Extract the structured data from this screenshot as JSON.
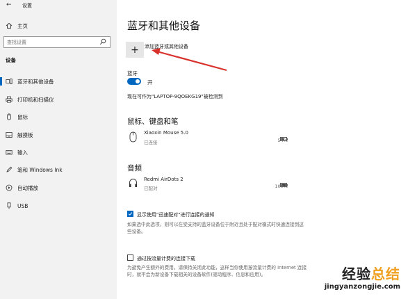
{
  "window": {
    "title": "设置"
  },
  "sidebar": {
    "home_label": "主页",
    "search_placeholder": "查找设置",
    "section_label": "设备",
    "items": [
      {
        "label": "蓝牙和其他设备",
        "icon": "bluetooth-devices-icon",
        "active": true
      },
      {
        "label": "打印机和扫描仪",
        "icon": "printer-icon"
      },
      {
        "label": "鼠标",
        "icon": "mouse-icon"
      },
      {
        "label": "触摸板",
        "icon": "touchpad-icon"
      },
      {
        "label": "输入",
        "icon": "keyboard-icon"
      },
      {
        "label": "笔和 Windows Ink",
        "icon": "pen-icon"
      },
      {
        "label": "自动播放",
        "icon": "autoplay-icon"
      },
      {
        "label": "USB",
        "icon": "usb-icon"
      }
    ]
  },
  "main": {
    "title": "蓝牙和其他设备",
    "add_device_label": "添加蓝牙或其他设备",
    "bluetooth_label": "蓝牙",
    "bluetooth_state": "开",
    "discoverable_text": "现在可作为\"LAPTOP-9QOEKG19\"被检测到",
    "categories": [
      {
        "title": "鼠标、键盘和笔",
        "devices": [
          {
            "name": "Xiaoxin Mouse 5.0",
            "status": "已连接",
            "battery": "54%",
            "icon": "mouse-icon"
          }
        ]
      },
      {
        "title": "音频",
        "devices": [
          {
            "name": "Redmi AirDots 2",
            "status": "已配对",
            "battery": "100%",
            "icon": "headphones-icon"
          }
        ]
      }
    ],
    "swift_pair": {
      "checked": true,
      "label": "显示使用\"迅速配对\"进行连接的通知",
      "description": "如果选中此选项，则可以在受支持的蓝牙设备位于附近且处于配对模式时快速连接到这些设备。"
    },
    "metered": {
      "checked": false,
      "label": "通过按流量计费的连接下载",
      "description": "为避免产生额外的费用，请保持关闭此功能，这样当你使用按流量计费的 Internet 连接时，就不会为新设备下载相关的设备软件(驱动程序、信息和应用)。"
    }
  },
  "watermark": {
    "text_a": "经验",
    "text_b": "总结",
    "url": "jingyanzongjie.com"
  },
  "colors": {
    "accent": "#0067c0",
    "arrow": "#d9312b",
    "sidebar_bg": "#f2f2f2"
  }
}
